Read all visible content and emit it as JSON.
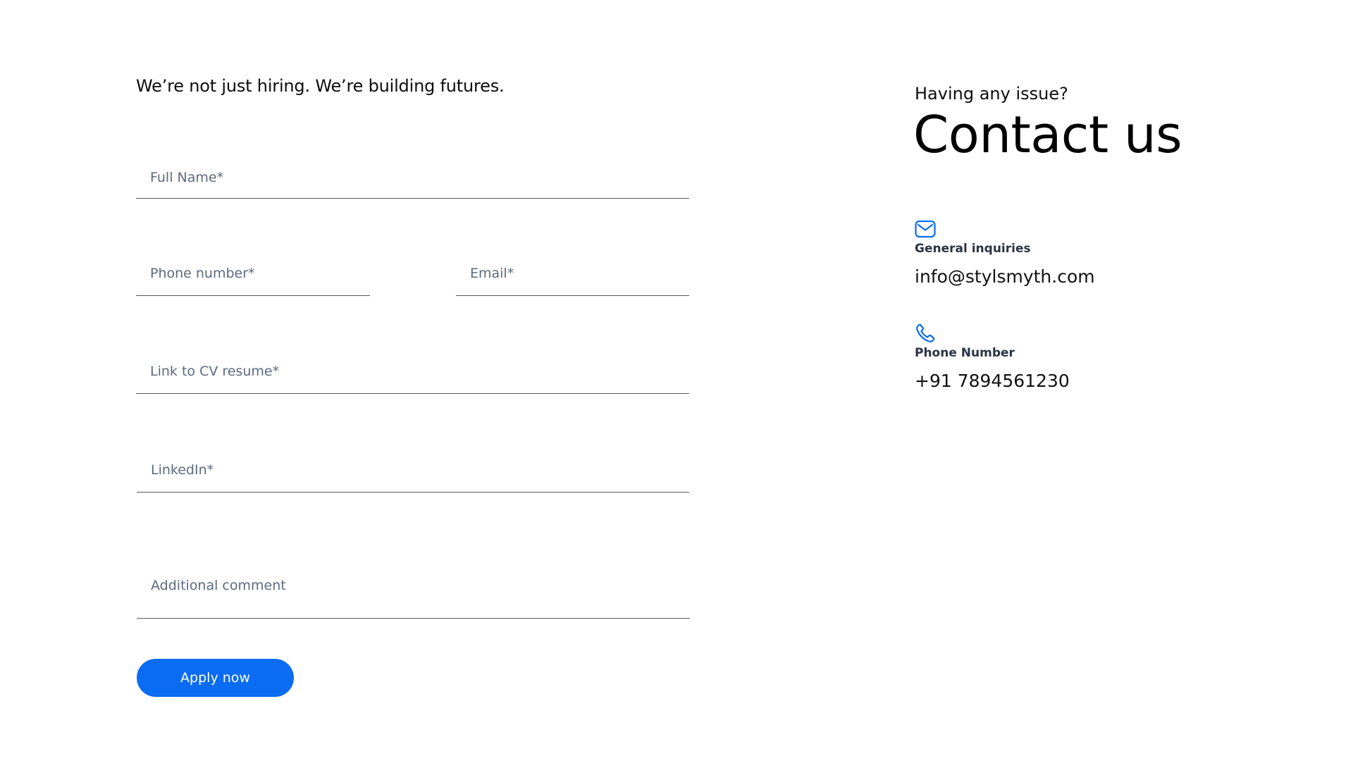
{
  "form": {
    "tagline": "We’re not just hiring. We’re building futures.",
    "fields": {
      "full_name": {
        "placeholder": "Full Name*",
        "value": ""
      },
      "phone": {
        "placeholder": "Phone number*",
        "value": ""
      },
      "email": {
        "placeholder": "Email*",
        "value": ""
      },
      "cv_link": {
        "placeholder": "Link to CV resume*",
        "value": ""
      },
      "linkedin": {
        "placeholder": "LinkedIn*",
        "value": ""
      },
      "comment": {
        "placeholder": "Additional comment",
        "value": ""
      }
    },
    "submit_label": "Apply now"
  },
  "contact": {
    "subheading": "Having any issue?",
    "heading": "Contact us",
    "items": [
      {
        "icon": "mail-icon",
        "label": "General inquiries",
        "value": "info@stylsmyth.com"
      },
      {
        "icon": "phone-icon",
        "label": "Phone Number",
        "value": "+91 7894561230"
      }
    ]
  },
  "colors": {
    "accent": "#0a6cf2",
    "field_underline": "#5a5a5a",
    "placeholder": "#5b6b80",
    "label": "#2a3445"
  }
}
